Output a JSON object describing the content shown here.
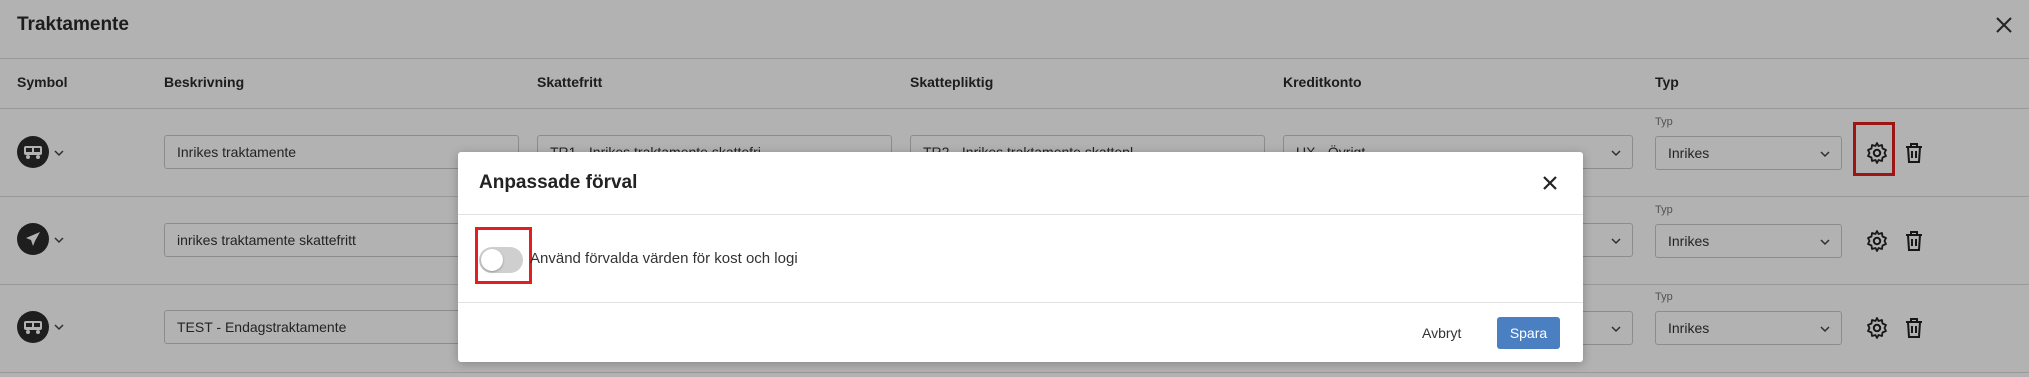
{
  "header": {
    "title": "Traktamente"
  },
  "columns": {
    "symbol": "Symbol",
    "beskrivning": "Beskrivning",
    "skattefritt": "Skattefritt",
    "skattepliktig": "Skattepliktig",
    "kreditkonto": "Kreditkonto",
    "typ": "Typ"
  },
  "rows": [
    {
      "icon": "bus-icon",
      "beskrivning": "Inrikes traktamente",
      "skattefritt": "TR1 - Inrikes traktamente skattefri",
      "skattepliktig": "TR2 - Inrikes traktamente skattepl.",
      "kreditkonto": "UX - Övrigt",
      "typ_label": "Typ",
      "typ": "Inrikes"
    },
    {
      "icon": "airplane-icon",
      "beskrivning": "inrikes traktamente skattefritt",
      "typ_label": "Typ",
      "typ": "Inrikes"
    },
    {
      "icon": "bus-icon",
      "beskrivning": "TEST - Endagstraktamente",
      "typ_label": "Typ",
      "typ": "Inrikes"
    }
  ],
  "modal": {
    "title": "Anpassade förval",
    "toggle_label": "Använd förvalda värden för kost och logi",
    "toggle_on": false,
    "cancel_label": "Avbryt",
    "save_label": "Spara"
  },
  "colors": {
    "primary": "#4a7fc1",
    "highlight": "#e02020",
    "icon_bg": "#2b2b2b"
  }
}
